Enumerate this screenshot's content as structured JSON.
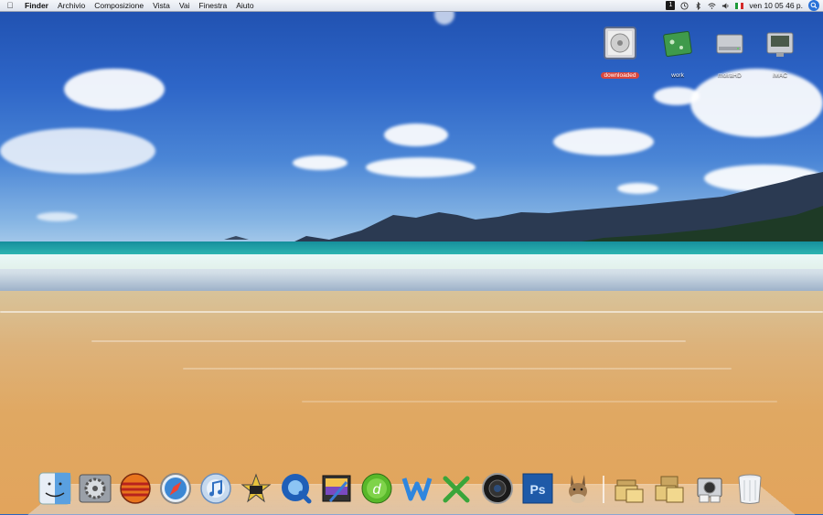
{
  "menubar": {
    "app_name": "Finder",
    "menus": [
      "Archivio",
      "Composizione",
      "Vista",
      "Vai",
      "Finestra",
      "Aiuto"
    ],
    "spotlight_badge": "1",
    "clock": "ven 10 05 46 p.",
    "icons": [
      "apple-icon",
      "spotlight-badge-icon",
      "time-machine-icon",
      "bluetooth-icon",
      "wifi-icon",
      "volume-icon",
      "flag-italy-icon",
      "spotlight-icon"
    ]
  },
  "desktop_icons": [
    {
      "name": "downloaded",
      "selected": true
    },
    {
      "name": "work",
      "selected": false
    },
    {
      "name": "moiraHD",
      "selected": false
    },
    {
      "name": "iMAC",
      "selected": false
    }
  ],
  "dock": {
    "apps": [
      "finder",
      "system-preferences",
      "firefox",
      "safari",
      "itunes",
      "imovie",
      "quicktime",
      "iphoto",
      "dreamweaver",
      "word",
      "excel",
      "aperture",
      "photoshop",
      "amule"
    ],
    "folders": [
      "applications-stack",
      "documents-stack",
      "downloads-stack",
      "trash"
    ]
  },
  "colors": {
    "selection_red": "#d9463c",
    "photoshop_blue": "#1e5aa8"
  }
}
